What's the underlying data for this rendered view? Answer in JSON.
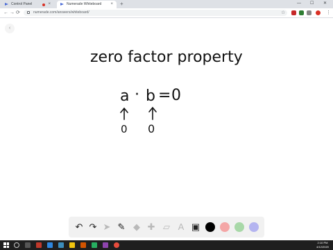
{
  "browser": {
    "tabs": [
      {
        "label": "Control Panel"
      },
      {
        "label": "Numerade Whiteboard"
      }
    ],
    "new_tab_label": "+",
    "window_controls": {
      "minimize": "—",
      "maximize": "☐",
      "close": "✕"
    },
    "url": "numerade.com/answers/whiteboard/",
    "nav": {
      "back": "←",
      "forward": "→",
      "reload": "⟳"
    }
  },
  "whiteboard": {
    "back_icon": "‹",
    "heading": "zero factor property",
    "equation": {
      "left": "a",
      "dot": "·",
      "right": "b",
      "equals": "=",
      "zero": "0"
    },
    "annotation": {
      "under_a": "0",
      "under_b": "0"
    }
  },
  "palette": {
    "tools": [
      "undo-icon",
      "redo-icon",
      "pointer-icon",
      "pen-icon",
      "shapes-icon",
      "add-icon",
      "eraser-icon",
      "text-icon",
      "image-icon"
    ],
    "colors": [
      "#000000",
      "#f4a6a6",
      "#a8d8a8",
      "#b4b4f0"
    ]
  },
  "taskbar": {
    "time": "2:10 PM",
    "date": "4/12/2020"
  },
  "colors": {
    "accent": "#4b6bd6",
    "recording": "#d93025"
  }
}
